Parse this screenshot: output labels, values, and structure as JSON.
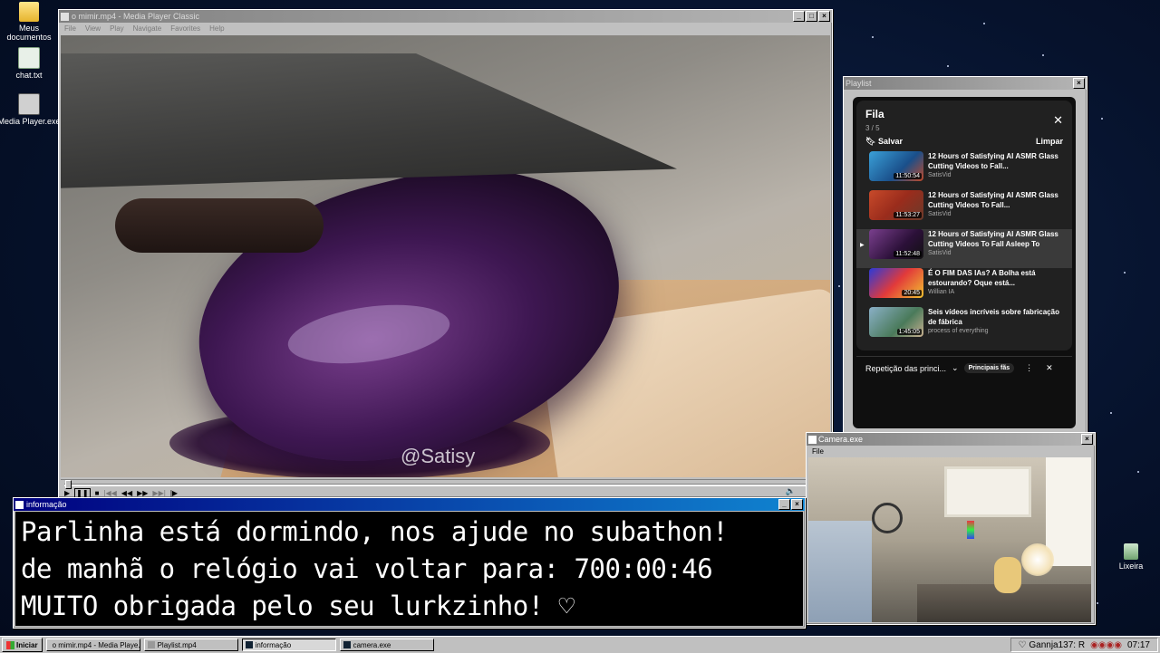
{
  "desktop": {
    "icons": [
      {
        "label": "Meus documentos",
        "icon": "folder-icon"
      },
      {
        "label": "chat.txt",
        "icon": "text-file-icon"
      },
      {
        "label": "Media Player.exe",
        "icon": "media-player-icon"
      },
      {
        "label": "Lixeira",
        "icon": "recycle-bin-icon"
      }
    ]
  },
  "media_player": {
    "title": "o mimir.mp4 - Media Player Classic",
    "menu": [
      "File",
      "View",
      "Play",
      "Navigate",
      "Favorites",
      "Help"
    ],
    "watermark": "@Satisy",
    "controls": [
      "play",
      "pause",
      "stop",
      "prev",
      "rewind",
      "forward",
      "next",
      "frame-step"
    ]
  },
  "info_window": {
    "title": "informação",
    "lines": [
      "Parlinha está dormindo, nos ajude no subathon!",
      "de manhã o relógio vai voltar para:  700:00:46",
      "MUITO obrigada pelo seu lurkzinho! ♡"
    ]
  },
  "playlist_window": {
    "title": "Playlist",
    "queue_title": "Fila",
    "position": "3 / 5",
    "save_label": "Salvar",
    "clear_label": "Limpar",
    "items": [
      {
        "title": "12 Hours of Satisfying AI ASMR Glass Cutting Videos to Fall...",
        "channel": "SatisVid",
        "duration": "11:50:54",
        "active": false
      },
      {
        "title": "12 Hours of Satisfying AI ASMR Glass Cutting Videos To Fall...",
        "channel": "SatisVid",
        "duration": "11:53:27",
        "active": false
      },
      {
        "title": "12 Hours of Satisfying AI ASMR Glass Cutting Videos To Fall Asleep To",
        "channel": "SatisVid",
        "duration": "11:52:48",
        "active": true
      },
      {
        "title": "É O FIM DAS IAs? A Bolha está estourando? Oque está...",
        "channel": "Willian IA",
        "duration": "20:45",
        "active": false
      },
      {
        "title": "Seis vídeos incríveis sobre fabricação de fábrica",
        "channel": "process of everything",
        "duration": "1:45:05",
        "active": false
      }
    ],
    "bottom_bar": {
      "label": "Repetição das princi...",
      "badge": "Principais fãs"
    }
  },
  "camera_window": {
    "title": "Camera.exe",
    "menu": [
      "File"
    ]
  },
  "taskbar": {
    "start_label": "Iniciar",
    "buttons": [
      {
        "label": "o mimir.mp4 - Media Playe...",
        "pressed": false
      },
      {
        "label": "Playlist.mp4",
        "pressed": false
      },
      {
        "label": "informação",
        "pressed": true
      },
      {
        "label": "camera.exe",
        "pressed": false
      }
    ],
    "tray_text": "♡ Gannja137: R",
    "clock": "07:17"
  },
  "colors": {
    "win_title_active": "#000080",
    "win_face": "#c0c0c0",
    "desktop": "#06122c",
    "yt_bg": "#0f0f0f"
  }
}
